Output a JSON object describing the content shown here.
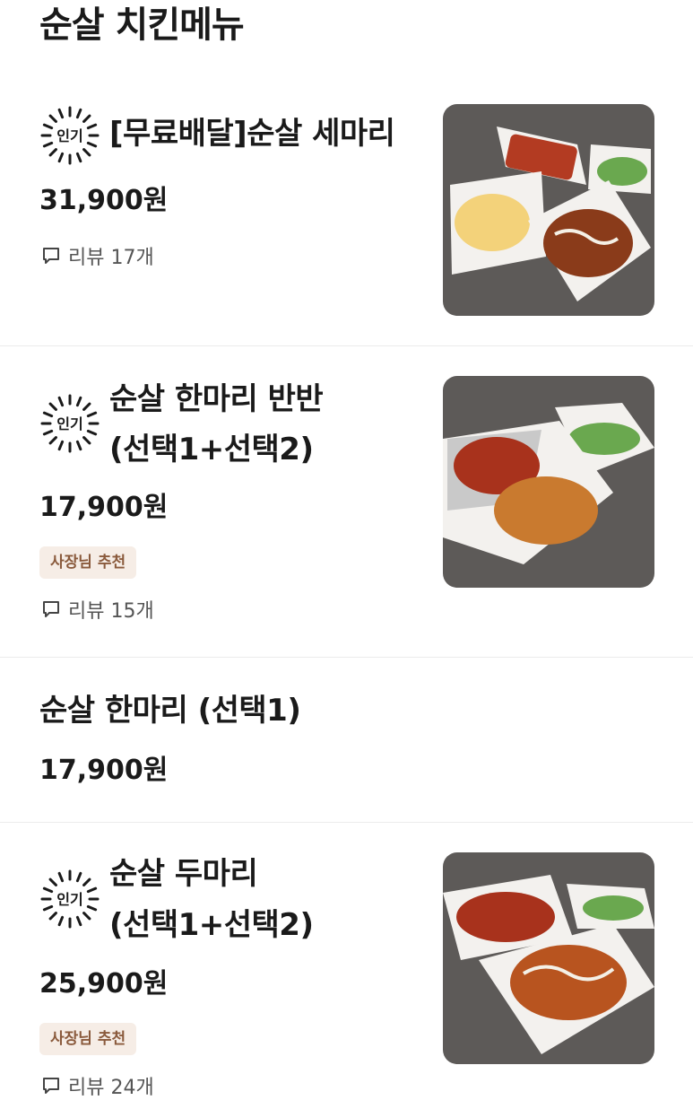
{
  "section": {
    "title": "순살 치킨메뉴"
  },
  "popular_label": "인기",
  "items": [
    {
      "name_line1": "[무료배달]순살 세마리",
      "name_line2": "",
      "price": "31,900원",
      "tag": "",
      "reviews": "리뷰 17개",
      "popular": true,
      "image": "chicken-three-image"
    },
    {
      "name_line1": "순살 한마리 반반",
      "name_line2": "(선택1+선택2)",
      "price": "17,900원",
      "tag": "사장님 추천",
      "reviews": "리뷰 15개",
      "popular": true,
      "image": "chicken-half-half-image"
    },
    {
      "name_line1": "순살 한마리 (선택1)",
      "name_line2": "",
      "price": "17,900원",
      "tag": "",
      "reviews": "",
      "popular": false,
      "image": ""
    },
    {
      "name_line1": "순살 두마리",
      "name_line2": "(선택1+선택2)",
      "price": "25,900원",
      "tag": "사장님 추천",
      "reviews": "리뷰 24개",
      "popular": true,
      "image": "chicken-two-image"
    }
  ],
  "colors": {
    "tag_bg": "#f6ede6",
    "tag_text": "#8a5a3c",
    "divider": "#ececec"
  }
}
